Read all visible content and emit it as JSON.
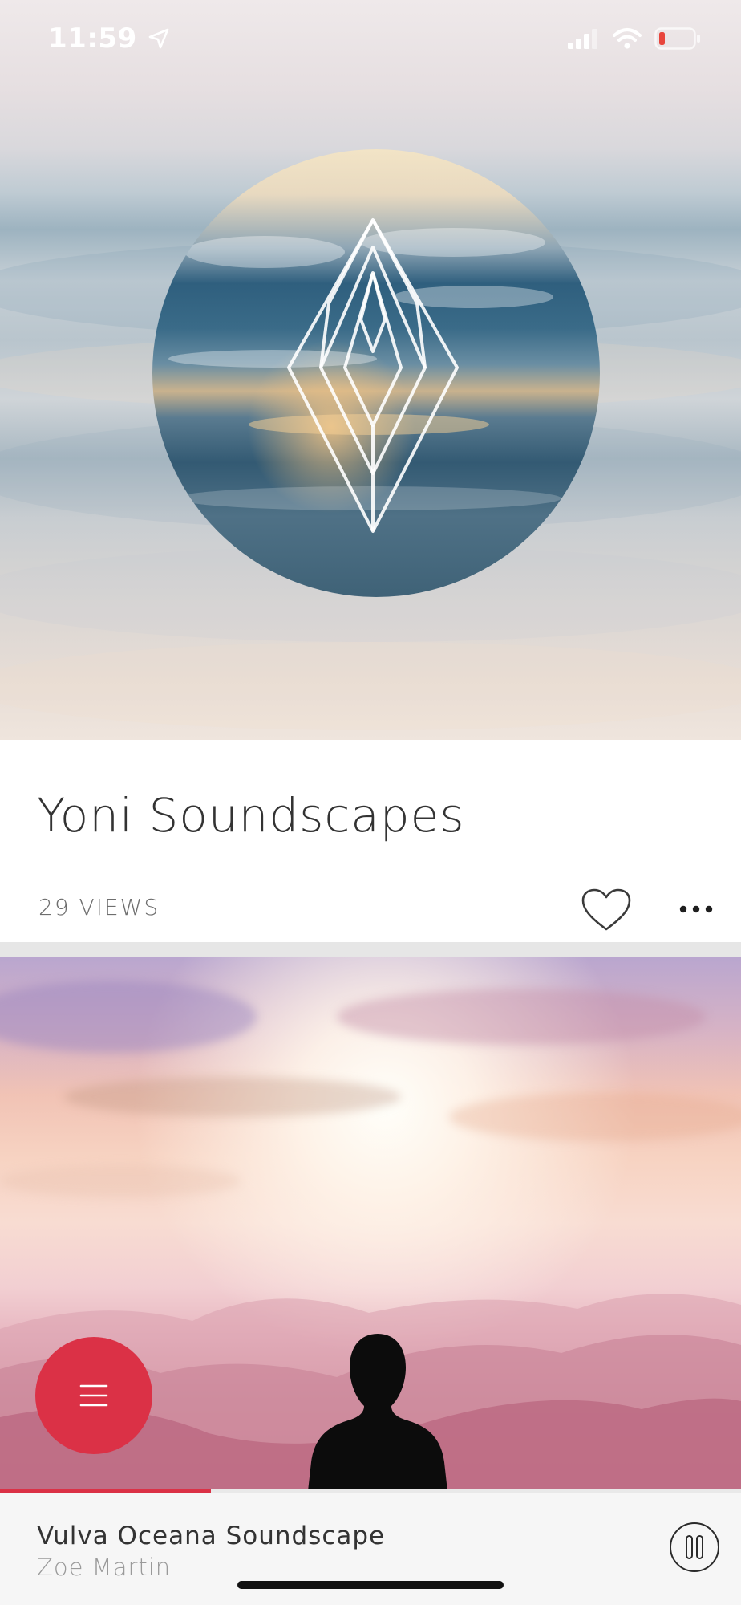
{
  "status_bar": {
    "time": "11:59",
    "location_icon": "location-arrow-icon",
    "signal_icon": "cellular-signal-icon",
    "wifi_icon": "wifi-icon",
    "battery_icon": "battery-low-icon",
    "battery_color": "#e8453c"
  },
  "hero": {
    "logo_icon": "yoni-crystal-logo-icon"
  },
  "track": {
    "title": "Yoni Soundscapes",
    "views": "29 VIEWS",
    "favorite_icon": "heart-outline-icon",
    "more_icon": "more-horizontal-icon"
  },
  "fab": {
    "icon": "hamburger-menu-icon",
    "color": "#db3146"
  },
  "player": {
    "title": "Vulva Oceana Soundscape",
    "artist": "Zoe Martin",
    "progress": 0.285,
    "pause_icon": "pause-circle-icon",
    "accent": "#db3146"
  }
}
